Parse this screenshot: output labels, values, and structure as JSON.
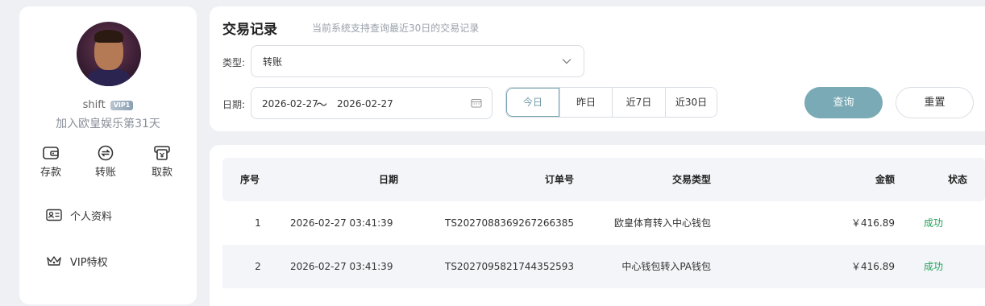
{
  "profile": {
    "username": "shift",
    "vip_badge": "VIP1",
    "join_text": "加入欧皇娱乐第31天"
  },
  "quick_actions": [
    {
      "label": "存款",
      "icon": "wallet-icon"
    },
    {
      "label": "转账",
      "icon": "transfer-icon"
    },
    {
      "label": "取款",
      "icon": "withdraw-icon"
    }
  ],
  "menu": [
    {
      "label": "个人资料",
      "icon": "id-card-icon"
    },
    {
      "label": "VIP特权",
      "icon": "crown-icon"
    }
  ],
  "header": {
    "title": "交易记录",
    "subtitle": "当前系统支持查询最近30日的交易记录"
  },
  "filters": {
    "type_label": "类型:",
    "type_value": "转账",
    "date_label": "日期:",
    "date_start": "2026-02-27",
    "date_sep": "〜",
    "date_end": "2026-02-27",
    "ranges": [
      "今日",
      "昨日",
      "近7日",
      "近30日"
    ],
    "active_range": "今日",
    "query_label": "查询",
    "reset_label": "重置"
  },
  "table": {
    "columns": [
      "序号",
      "日期",
      "订单号",
      "交易类型",
      "金额",
      "状态"
    ],
    "rows": [
      {
        "seq": "1",
        "date": "2026-02-27 03:41:39",
        "order": "TS2027088369267266385",
        "type": "欧皇体育转入中心钱包",
        "amount": "￥416.89",
        "status": "成功"
      },
      {
        "seq": "2",
        "date": "2026-02-27 03:41:39",
        "order": "TS2027095821744352593",
        "type": "中心钱包转入PA钱包",
        "amount": "￥416.89",
        "status": "成功"
      }
    ]
  },
  "colors": {
    "accent": "#79aab5",
    "success": "#22a05a",
    "background": "#eef0f4"
  }
}
